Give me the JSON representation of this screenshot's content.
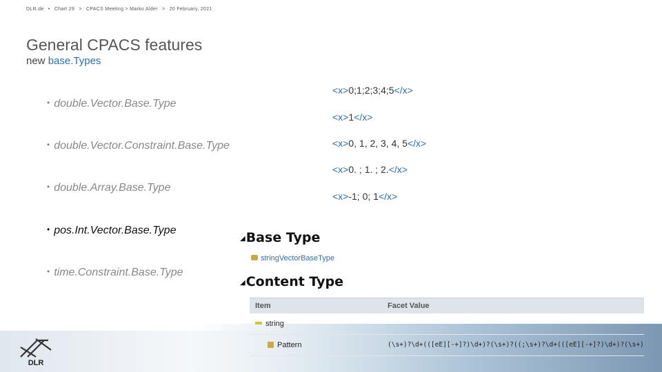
{
  "header": {
    "org": "DLR.de",
    "sep1": "•",
    "chart": "Chart 29",
    "sep2": ">",
    "meeting": "CPACS Meeting > Marko Alder",
    "sep3": ">",
    "date": "20 February, 2021"
  },
  "title": "General CPACS features",
  "subtitle": {
    "prefix": "new",
    "highlight": "base.Types"
  },
  "bullets": [
    {
      "text": "double.Vector.Base.Type",
      "style": "light"
    },
    {
      "text": "double.Vector.Constraint.Base.Type",
      "style": "light"
    },
    {
      "text": "double.Array.Base.Type",
      "style": "light"
    },
    {
      "text": "pos.Int.Vector.Base.Type",
      "style": "dark"
    },
    {
      "text": "time.Constraint.Base.Type",
      "style": "light"
    }
  ],
  "bullet_glyph": "•",
  "xml_examples": [
    {
      "open": "<x>",
      "value": "0;1;2;3;4;5",
      "close": "</x>"
    },
    {
      "open": "<x>",
      "value": "1",
      "close": "</x>"
    },
    {
      "open": "<x>",
      "value": "0, 1, 2, 3, 4, 5",
      "close": "</x>"
    },
    {
      "open": "<x>",
      "value": "0. ; 1. ; 2.",
      "close": "</x>"
    },
    {
      "open": "<x>",
      "value": "-1; 0; 1",
      "close": "</x>"
    }
  ],
  "screenshot": {
    "base_type_title": "Base Type",
    "base_type_link": "stringVectorBaseType",
    "content_type_title": "Content Type",
    "collapse_glyph": "◢",
    "table": {
      "headers": [
        "Item",
        "Facet Value"
      ],
      "rows": [
        {
          "item": "string",
          "value": ""
        },
        {
          "item": "Pattern",
          "value": "(\\s+)?\\d+(([eE][-+]?)\\d+)?(\\s+)?((;\\s+)?\\d+(([eE][-+]?)\\d+)?(\\s+)?)*"
        }
      ]
    }
  },
  "logo": {
    "text": "DLR"
  },
  "colors": {
    "accent": "#2f6fa8",
    "title": "#555555"
  }
}
